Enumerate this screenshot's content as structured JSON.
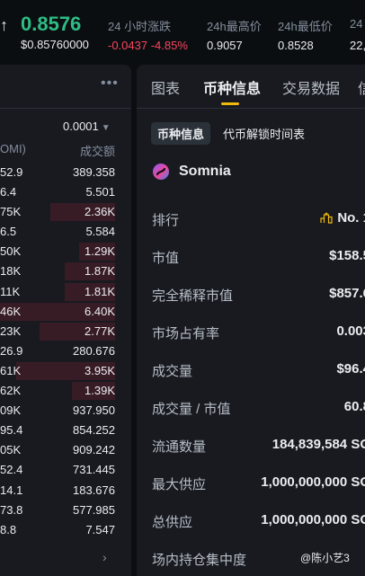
{
  "ticker": {
    "arrow": "↑",
    "price": "0.8576",
    "price_fiat": "$0.85760000",
    "stats": [
      {
        "label": "24 小时涨跌",
        "value": "-0.0437 -4.85%"
      },
      {
        "label": "24h最高价",
        "value": "0.9057"
      },
      {
        "label": "24h最低价",
        "value": "0.8528"
      },
      {
        "label": "24",
        "value": "22,"
      }
    ]
  },
  "orderbook": {
    "more": "•••",
    "precision": "0.0001",
    "chevron": "▼",
    "col_left": "OMI)",
    "col_right": "成交额",
    "rows": [
      {
        "left": "52.9",
        "right": "389.358"
      },
      {
        "left": "6.4",
        "right": "5.501"
      },
      {
        "left": "75K",
        "right": "2.36K"
      },
      {
        "left": "6.5",
        "right": "5.584"
      },
      {
        "left": "50K",
        "right": "1.29K"
      },
      {
        "left": "18K",
        "right": "1.87K"
      },
      {
        "left": "11K",
        "right": "1.81K"
      },
      {
        "left": "46K",
        "right": "6.40K"
      },
      {
        "left": "23K",
        "right": "2.77K"
      },
      {
        "left": "26.9",
        "right": "280.676"
      },
      {
        "left": "61K",
        "right": "3.95K"
      },
      {
        "left": "62K",
        "right": "1.39K"
      },
      {
        "left": "09K",
        "right": "937.950"
      },
      {
        "left": "95.4",
        "right": "854.252"
      },
      {
        "left": "05K",
        "right": "909.242"
      },
      {
        "left": "52.4",
        "right": "731.445"
      },
      {
        "left": "14.1",
        "right": "183.676"
      },
      {
        "left": "73.8",
        "right": "577.985"
      },
      {
        "left": "8.8",
        "right": "7.547"
      }
    ],
    "next": "›"
  },
  "info": {
    "tabs": [
      "图表",
      "币种信息",
      "交易数据",
      "信"
    ],
    "chip_active": "币种信息",
    "chip_other": "代币解锁时间表",
    "coin_name": "Somnia",
    "rows": [
      {
        "key": "排行",
        "value": "No. 1"
      },
      {
        "key": "市值",
        "value": "$158.5"
      },
      {
        "key": "完全稀释市值",
        "value": "$857.6"
      },
      {
        "key": "市场占有率",
        "value": "0.003"
      },
      {
        "key": "成交量",
        "value": "$96.4"
      },
      {
        "key": "成交量 / 市值",
        "value": "60.8"
      },
      {
        "key": "流通数量",
        "value": "184,839,584 SO"
      },
      {
        "key": "最大供应",
        "value": "1,000,000,000 SO"
      },
      {
        "key": "总供应",
        "value": "1,000,000,000 SO"
      },
      {
        "key": "场内持仓集中度",
        "value": ""
      }
    ],
    "watermark": "@陈小艺3"
  },
  "colors": {
    "up": "#2ebd85",
    "down": "#f6465d",
    "accent": "#f0b90b",
    "bg": "#0b0e11",
    "panel": "#181a20"
  }
}
